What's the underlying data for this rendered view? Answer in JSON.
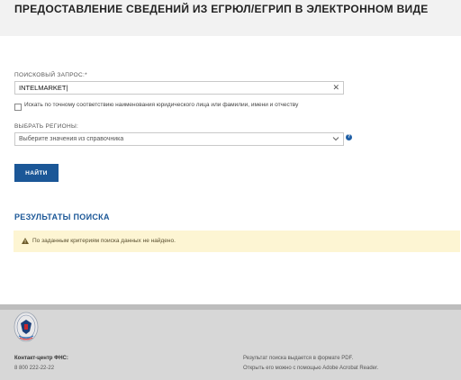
{
  "header": {
    "title": "ПРЕДОСТАВЛЕНИЕ СВЕДЕНИЙ ИЗ ЕГРЮЛ/ЕГРИП В ЭЛЕКТРОННОМ ВИДЕ"
  },
  "search": {
    "label": "ПОИСКОВЫЙ ЗАПРОС:*",
    "value": "INTELMARKET|",
    "clear_icon": "close-icon"
  },
  "exact_match": {
    "checked": false,
    "label": "Искать по точному соответствию наименования юридического лица или фамилии, имени и отчеству"
  },
  "regions": {
    "label": "ВЫБРАТЬ РЕГИОНЫ:",
    "placeholder": "Выберите значения из справочника",
    "info_icon": "info-icon"
  },
  "find_button": {
    "label": "НАЙТИ"
  },
  "results": {
    "title": "РЕЗУЛЬТАТЫ ПОИСКА",
    "alert": "По заданным критериям поиска данных не найдено.",
    "alert_icon": "warning-icon"
  },
  "footer": {
    "contact_title": "Контакт-центр ФНС:",
    "contact_phone": "8 800 222-22-22",
    "pdf_note_1": "Результат поиска выдается в формате PDF.",
    "pdf_note_2": "Открыть его можно с помощью Adobe Acrobat Reader."
  },
  "colors": {
    "accent": "#1b5797",
    "alert_bg": "#fdf5d3",
    "footer_bg": "#d7d7d7",
    "header_bg": "#f2f2f2"
  }
}
